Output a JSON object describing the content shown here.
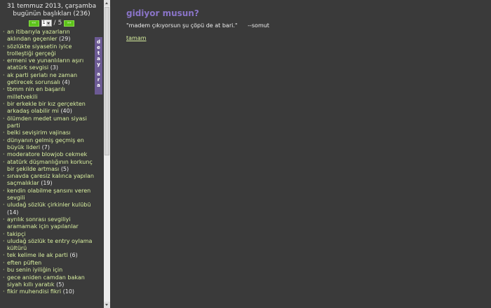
{
  "sidebar": {
    "date_line": "31 temmuz 2013, çarşamba",
    "headlines_line": "bugünün başlıkları (236)",
    "pager": {
      "prev_label": "««",
      "current_page": "1",
      "separator": "/",
      "total_pages": "5",
      "next_label": "»»"
    },
    "detay_tab": [
      "d",
      "e",
      "t",
      "a",
      "y",
      "a",
      "r",
      "a"
    ],
    "topics": [
      {
        "title": "an itibarıyla yazarların aklından geçenler",
        "count": "(29)"
      },
      {
        "title": "sözlükte siyasetin iyice trolleştiği gerçeği",
        "count": ""
      },
      {
        "title": "ermeni ve yunanlıların aşırı atatürk sevgisi",
        "count": "(3)"
      },
      {
        "title": "ak parti şeriatı ne zaman getirecek sorunsalı",
        "count": "(4)"
      },
      {
        "title": "tbmm nin en başarılı milletvekili",
        "count": ""
      },
      {
        "title": "bir erkekle bir kız gerçekten arkadaş olabilir mi",
        "count": "(40)"
      },
      {
        "title": "ölümden medet uman siyasi parti",
        "count": ""
      },
      {
        "title": "belki sevişirim vajinası",
        "count": ""
      },
      {
        "title": "dünyanın gelmiş geçmiş en büyük lideri",
        "count": "(7)"
      },
      {
        "title": "moderatore blowjob cekmek",
        "count": ""
      },
      {
        "title": "atatürk düşmanlığının korkunç bir şekilde artması",
        "count": "(5)"
      },
      {
        "title": "sınavda çaresiz kalınca yapılan saçmalıklar",
        "count": "(19)"
      },
      {
        "title": "kendin olabilme şansını veren sevgili",
        "count": ""
      },
      {
        "title": "uludağ sözlük çirkinler kulübü",
        "count": "(14)"
      },
      {
        "title": "ayrılık sonrası sevgiliyi aramamak için yapılanlar",
        "count": ""
      },
      {
        "title": "takipçi",
        "count": ""
      },
      {
        "title": "uludağ sözlük te entry oylama kültürü",
        "count": ""
      },
      {
        "title": "tek kelime ile ak parti",
        "count": "(6)"
      },
      {
        "title": "eften püften",
        "count": ""
      },
      {
        "title": "bu senin iyiliğin için",
        "count": ""
      },
      {
        "title": "gece aniden camdan bakan siyah kıllı yaratık",
        "count": "(5)"
      },
      {
        "title": "fikir muhendisi fikri",
        "count": "(10)"
      }
    ]
  },
  "main": {
    "title": "gidiyor musun?",
    "quote": "\"madem çıkıyorsun şu çöpü de at bari.\"",
    "author": "--somut",
    "ok_label": "tamam"
  },
  "colors": {
    "background": "#3a3a3a",
    "topic_link": "#d9f0a0",
    "title_purple": "#8a74c8",
    "tab_purple": "#6c5a94",
    "button_green": "#5cc21a"
  }
}
